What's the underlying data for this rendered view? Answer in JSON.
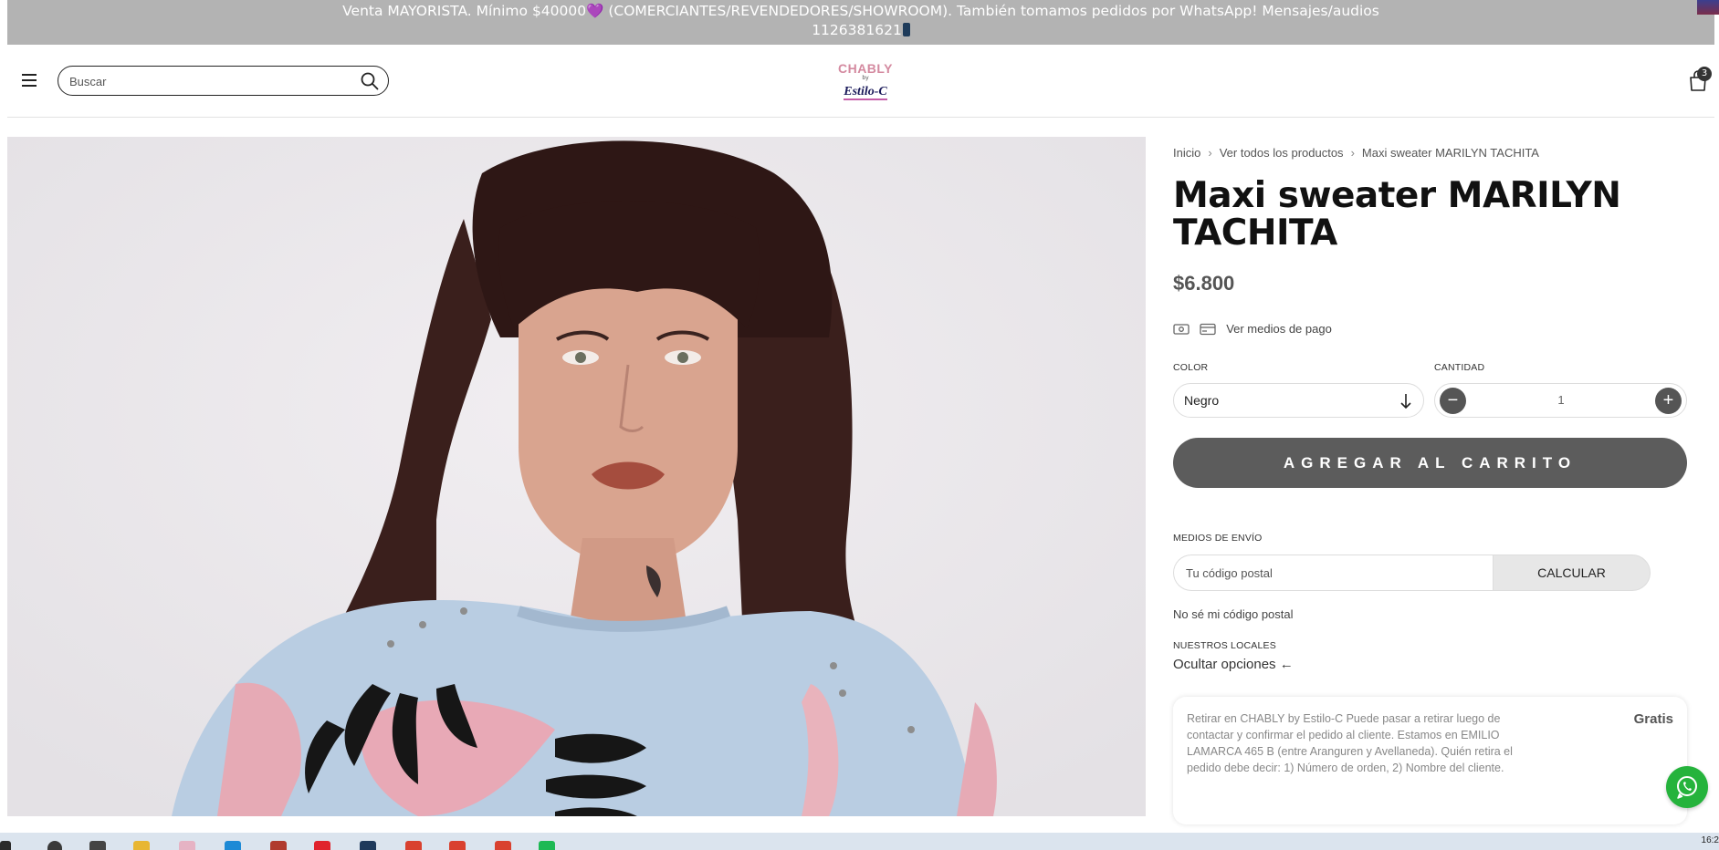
{
  "announcement": {
    "line1_prefix": "Venta MAYORISTA. Mínimo $40000",
    "line1_heart": "💜",
    "line1_suffix": " (COMERCIANTES/REVENDEDORES/SHOWROOM). También tomamos pedidos por WhatsApp! Mensajes/audios",
    "line2": "1126381621"
  },
  "header": {
    "search_placeholder": "Buscar",
    "logo": {
      "line1": "CHABLY",
      "line2": "by",
      "line3": "Estilo-C"
    },
    "cart_count": "3"
  },
  "breadcrumb": {
    "items": [
      "Inicio",
      "Ver todos los productos",
      "Maxi sweater MARILYN TACHITA"
    ],
    "separator": "›"
  },
  "product": {
    "title": "Maxi sweater MARILYN TACHITA",
    "price": "$6.800",
    "payment_link": "Ver medios de pago",
    "color_label": "COLOR",
    "color_value": "Negro",
    "quantity_label": "CANTIDAD",
    "quantity_value": "1",
    "quantity_minus": "−",
    "quantity_plus": "+",
    "add_to_cart": "AGREGAR AL CARRITO"
  },
  "shipping": {
    "label": "MEDIOS DE ENVÍO",
    "postal_placeholder": "Tu código postal",
    "calculate": "CALCULAR",
    "unknown_postal": "No sé mi código postal",
    "stores_label": "NUESTROS LOCALES",
    "hide_options": "Ocultar opciones ←",
    "pickup_text": "Retirar en CHABLY by Estilo-C  Puede pasar a retirar luego de contactar y confirmar el pedido al cliente. Estamos en EMILIO LAMARCA 465 B (entre Aranguren y Avellaneda). Quién retira el pedido debe decir: 1) Número de orden, 2) Nombre del cliente.",
    "pickup_price": "Gratis"
  },
  "taskbar": {
    "clock": "16:2"
  },
  "colors": {
    "announcement_bg": "#b3b3b3",
    "button_dark": "#5c5c5c",
    "whatsapp": "#25b33c",
    "logo_pink": "#d48aa0"
  }
}
